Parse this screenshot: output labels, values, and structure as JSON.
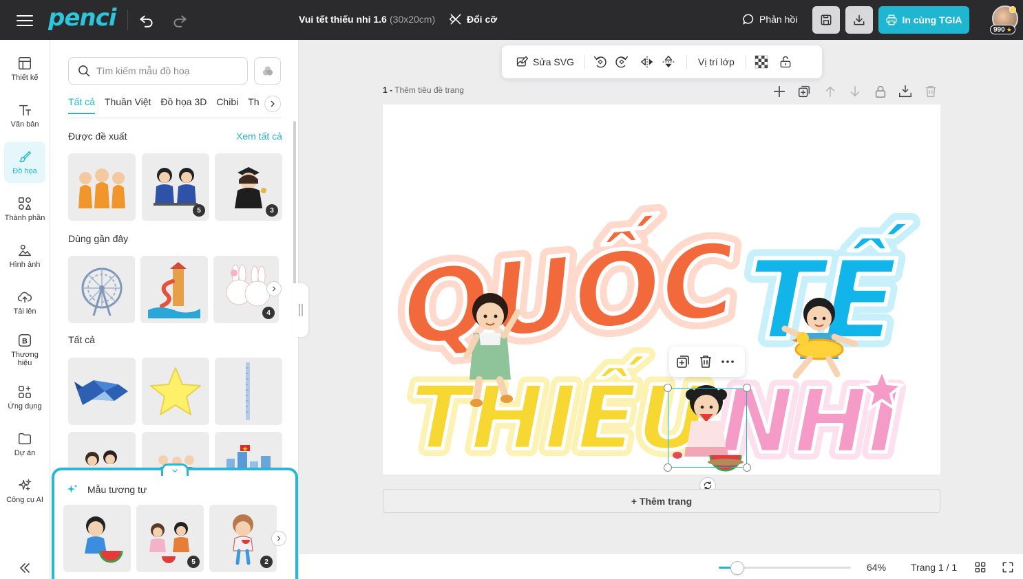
{
  "header": {
    "logo": "penci",
    "title": "Vui tết thiếu nhi 1.6",
    "size": "(30x20cm)",
    "resize_label": "Đổi cỡ",
    "feedback_label": "Phản hồi",
    "print_label": "In cùng TGIA",
    "coins": "990"
  },
  "leftnav": {
    "items": [
      {
        "label": "Thiết kế",
        "icon": "layout-icon"
      },
      {
        "label": "Văn bản",
        "icon": "text-icon"
      },
      {
        "label": "Đồ họa",
        "icon": "brush-icon"
      },
      {
        "label": "Thành phần",
        "icon": "shapes-icon"
      },
      {
        "label": "Hình ảnh",
        "icon": "image-icon"
      },
      {
        "label": "Tải lên",
        "icon": "upload-icon"
      },
      {
        "label": "Thương hiệu",
        "icon": "brand-icon"
      },
      {
        "label": "Ứng dụng",
        "icon": "apps-icon"
      },
      {
        "label": "Dự án",
        "icon": "folder-icon"
      },
      {
        "label": "Công cụ AI",
        "icon": "sparkle-icon"
      }
    ]
  },
  "panel": {
    "search_placeholder": "Tìm kiếm mẫu đồ hoạ",
    "tabs": [
      "Tất cả",
      "Thuần Việt",
      "Đồ họa 3D",
      "Chibi",
      "Th"
    ],
    "suggested_title": "Được đề xuất",
    "see_all": "Xem tất cả",
    "recent_title": "Dùng gần đây",
    "all_title": "Tất cả",
    "suggested_counts": [
      "",
      "5",
      "3"
    ],
    "recent_counts": [
      "",
      "",
      "4"
    ]
  },
  "similar": {
    "title": "Mẫu tương tự",
    "counts": [
      "",
      "5",
      "2"
    ]
  },
  "toolbar": {
    "edit_svg": "Sửa SVG",
    "layer_position": "Vị trí lớp"
  },
  "page": {
    "number": "1 -",
    "title_placeholder": "Thêm tiêu đề trang",
    "add_page": "+ Thêm trang"
  },
  "canvas": {
    "word1": "QUỐC",
    "word2": "TẾ",
    "word3": "THIẾU",
    "word4": "NHI"
  },
  "footer": {
    "zoom": "64%",
    "zoom_level": 0.14,
    "page_indicator": "Trang 1 / 1"
  },
  "colors": {
    "accent": "#1fb6d2",
    "orange": "#f26a3c",
    "blue": "#12b5ea",
    "yellow": "#f7d731",
    "pink": "#f59bc8"
  }
}
